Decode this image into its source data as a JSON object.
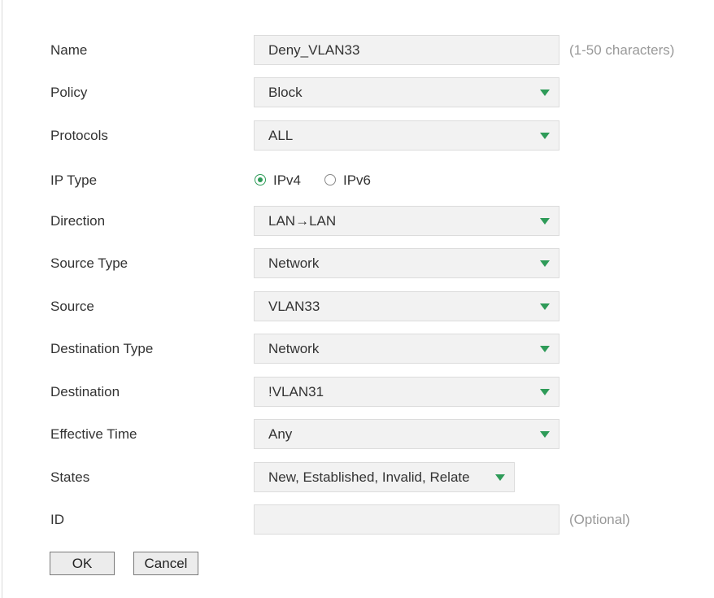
{
  "form": {
    "name": {
      "label": "Name",
      "value": "Deny_VLAN33",
      "hint": "(1-50 characters)"
    },
    "policy": {
      "label": "Policy",
      "value": "Block"
    },
    "protocols": {
      "label": "Protocols",
      "value": "ALL"
    },
    "ip_type": {
      "label": "IP Type",
      "options": [
        "IPv4",
        "IPv6"
      ],
      "selected": "IPv4"
    },
    "direction": {
      "label": "Direction",
      "value": "LAN→LAN"
    },
    "source_type": {
      "label": "Source Type",
      "value": "Network"
    },
    "source": {
      "label": "Source",
      "value": "VLAN33"
    },
    "destination_type": {
      "label": "Destination Type",
      "value": "Network"
    },
    "destination": {
      "label": "Destination",
      "value": "!VLAN31"
    },
    "effective_time": {
      "label": "Effective Time",
      "value": "Any"
    },
    "states": {
      "label": "States",
      "value": "New, Established, Invalid, Relate"
    },
    "id": {
      "label": "ID",
      "value": "",
      "hint": "(Optional)"
    }
  },
  "buttons": {
    "ok": "OK",
    "cancel": "Cancel"
  },
  "colors": {
    "accent": "#2e9b58",
    "field_bg": "#f2f2f2",
    "hint": "#999999"
  },
  "icons": {
    "dropdown": "triangle-down-icon"
  }
}
